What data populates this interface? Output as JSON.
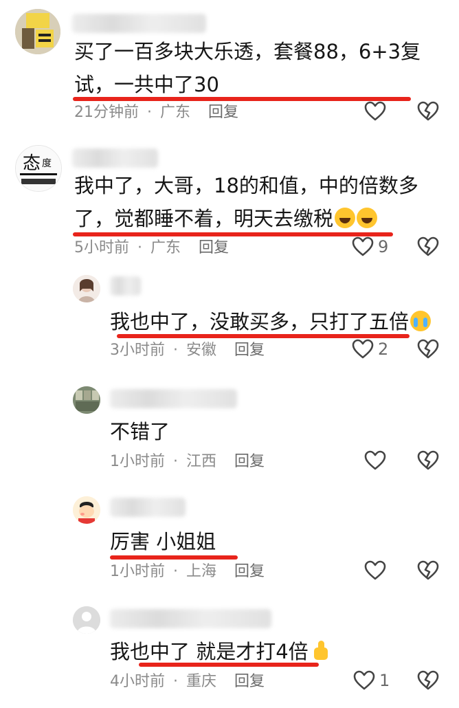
{
  "comments": [
    {
      "text_line1": "买了一百多块大乐透，套餐88，6+3复",
      "text_line2": "试，一共中了30",
      "time": "21分钟前",
      "location": "广东",
      "reply": "回复",
      "likes": ""
    },
    {
      "text_line1": "我中了，大哥，18的和值，中的倍数多",
      "text_line2": "了，觉都睡不着，明天去缴税",
      "time": "5小时前",
      "location": "广东",
      "reply": "回复",
      "likes": "9"
    },
    {
      "text": "我也中了，没敢买多，只打了五倍",
      "time": "3小时前",
      "location": "安徽",
      "reply": "回复",
      "likes": "2"
    },
    {
      "text": "不错了",
      "time": "1小时前",
      "location": "江西",
      "reply": "回复",
      "likes": ""
    },
    {
      "text": "厉害 小姐姐",
      "time": "1小时前",
      "location": "上海",
      "reply": "回复",
      "likes": ""
    },
    {
      "text": "我也中了 就是才打4倍",
      "time": "4小时前",
      "location": "重庆",
      "reply": "回复",
      "likes": "1"
    }
  ],
  "icons": {
    "like": "heart-outline-icon",
    "dislike": "broken-heart-icon",
    "emoji_laugh": "laughing-tears-emoji",
    "emoji_cry": "crying-emoji",
    "emoji_thumb": "thumbs-up-emoji"
  },
  "colors": {
    "underline": "#e8241b",
    "meta": "#8a8a8a",
    "text": "#161616",
    "icon": "#444444"
  }
}
